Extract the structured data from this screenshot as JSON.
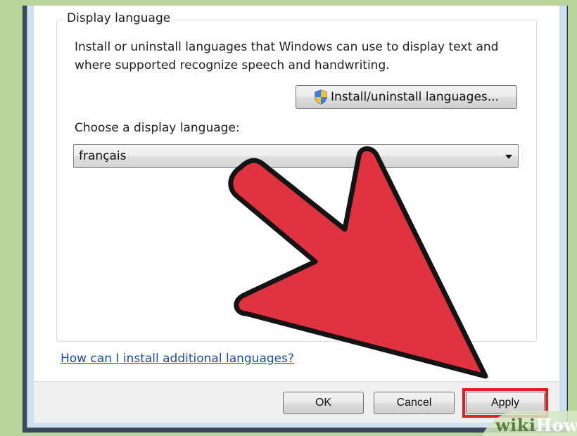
{
  "dialog": {
    "group_title": "Display language",
    "description": "Install or uninstall languages that Windows can use to display text and where supported recognize speech and handwriting.",
    "install_button_label": "Install/uninstall languages...",
    "shield_icon": "uac-shield-icon",
    "choose_label": "Choose a display language:",
    "selected_language": "français",
    "help_link": "How can I install additional languages?"
  },
  "buttons": {
    "ok": "OK",
    "cancel": "Cancel",
    "apply": "Apply"
  },
  "annotation": {
    "arrow_color": "#e0323f",
    "highlight_color": "#e41b23",
    "target": "apply-button"
  },
  "watermark": {
    "wiki": "wiki",
    "how": "How"
  },
  "colors": {
    "background": "#b9d59b",
    "link": "#1a4fa8"
  }
}
